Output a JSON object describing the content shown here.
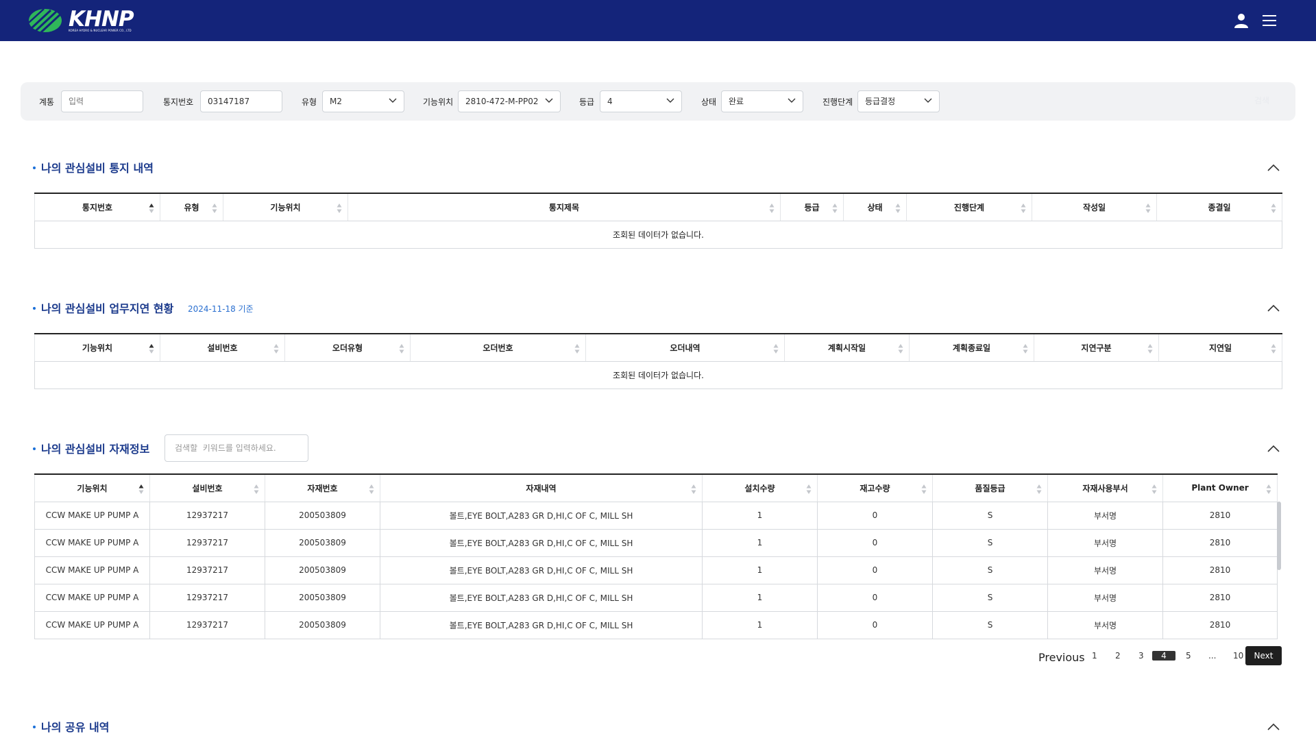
{
  "header": {
    "logo_text": "KHNP",
    "logo_sub": "KOREA HYDRO & NUCLEAR POWER CO., LTD",
    "colors": {
      "bar": "#14247a",
      "accent": "#2fb65a"
    }
  },
  "filters": {
    "system": {
      "label": "계통",
      "placeholder": "입력",
      "value": ""
    },
    "notice_no": {
      "label": "통지번호",
      "value": "03147187"
    },
    "type": {
      "label": "유형",
      "value": "M2"
    },
    "func_loc": {
      "label": "기능위치",
      "value": "2810-472-M-PP02"
    },
    "grade": {
      "label": "등급",
      "value": "4"
    },
    "status": {
      "label": "상태",
      "value": "완료"
    },
    "stage": {
      "label": "진행단계",
      "value": "등급결정"
    },
    "search_label": "검색"
  },
  "section1": {
    "title": "나의 관심설비 통지 내역",
    "columns": [
      "통지번호",
      "유형",
      "기능위치",
      "통지제목",
      "등급",
      "상태",
      "진행단계",
      "작성일",
      "종결일"
    ],
    "empty": "조회된 데이터가 없습니다."
  },
  "section2": {
    "title": "나의 관심설비 업무지연 현황",
    "date": "2024-11-18 기준",
    "columns": [
      "기능위치",
      "설비번호",
      "오더유형",
      "오더번호",
      "오더내역",
      "계획시작일",
      "계획종료일",
      "지연구분",
      "지연일"
    ],
    "empty": "조회된 데이터가 없습니다."
  },
  "section3": {
    "title": "나의 관심설비 자재정보",
    "search_placeholder": "검색할  키워드를 입력하세요.",
    "columns": [
      "기능위치",
      "설비번호",
      "자재번호",
      "자재내역",
      "설치수량",
      "재고수량",
      "품질등급",
      "자재사용부서",
      "Plant Owner"
    ],
    "rows": [
      [
        "CCW MAKE UP PUMP A",
        "12937217",
        "200503809",
        "볼트,EYE BOLT,A283 GR D,HI,C OF C, MILL SH",
        "1",
        "0",
        "S",
        "부서명",
        "2810"
      ],
      [
        "CCW MAKE UP PUMP A",
        "12937217",
        "200503809",
        "볼트,EYE BOLT,A283 GR D,HI,C OF C, MILL SH",
        "1",
        "0",
        "S",
        "부서명",
        "2810"
      ],
      [
        "CCW MAKE UP PUMP A",
        "12937217",
        "200503809",
        "볼트,EYE BOLT,A283 GR D,HI,C OF C, MILL SH",
        "1",
        "0",
        "S",
        "부서명",
        "2810"
      ],
      [
        "CCW MAKE UP PUMP A",
        "12937217",
        "200503809",
        "볼트,EYE BOLT,A283 GR D,HI,C OF C, MILL SH",
        "1",
        "0",
        "S",
        "부서명",
        "2810"
      ],
      [
        "CCW MAKE UP PUMP A",
        "12937217",
        "200503809",
        "볼트,EYE BOLT,A283 GR D,HI,C OF C, MILL SH",
        "1",
        "0",
        "S",
        "부서명",
        "2810"
      ]
    ]
  },
  "pagination": {
    "previous": "Previous",
    "pages": [
      "1",
      "2",
      "3",
      "4",
      "5",
      "...",
      "10"
    ],
    "current": "4",
    "next": "Next"
  },
  "section4": {
    "title": "나의 공유 내역"
  }
}
